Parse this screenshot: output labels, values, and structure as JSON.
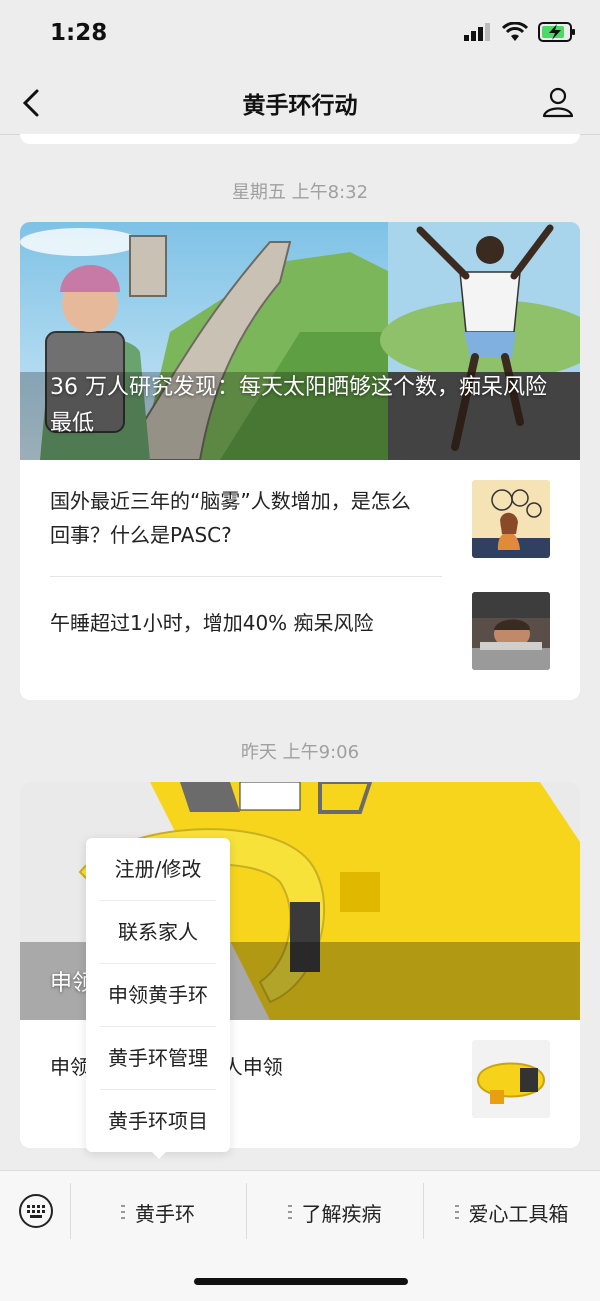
{
  "status": {
    "time": "1:28"
  },
  "header": {
    "title": "黄手环行动"
  },
  "messages": [
    {
      "timestamp": "星期五 上午8:32",
      "hero_title": "36 万人研究发现：每天太阳晒够这个数，痴呆风险最低",
      "articles": [
        {
          "title": "国外最近三年的“脑雾”人数增加，是怎么回事？什么是PASC?"
        },
        {
          "title": "午睡超过1小时，增加40% 痴呆风险"
        }
      ]
    },
    {
      "timestamp": "昨天 上午9:06",
      "hero_title": "申领",
      "articles": [
        {
          "title": "申领黄手环 —— 个人申领"
        }
      ]
    }
  ],
  "popup_menu": {
    "items": [
      "注册/修改",
      "联系家人",
      "申领黄手环",
      "黄手环管理",
      "黄手环项目"
    ]
  },
  "bottom_menu": {
    "tabs": [
      "黄手环",
      "了解疾病",
      "爱心工具箱"
    ]
  }
}
